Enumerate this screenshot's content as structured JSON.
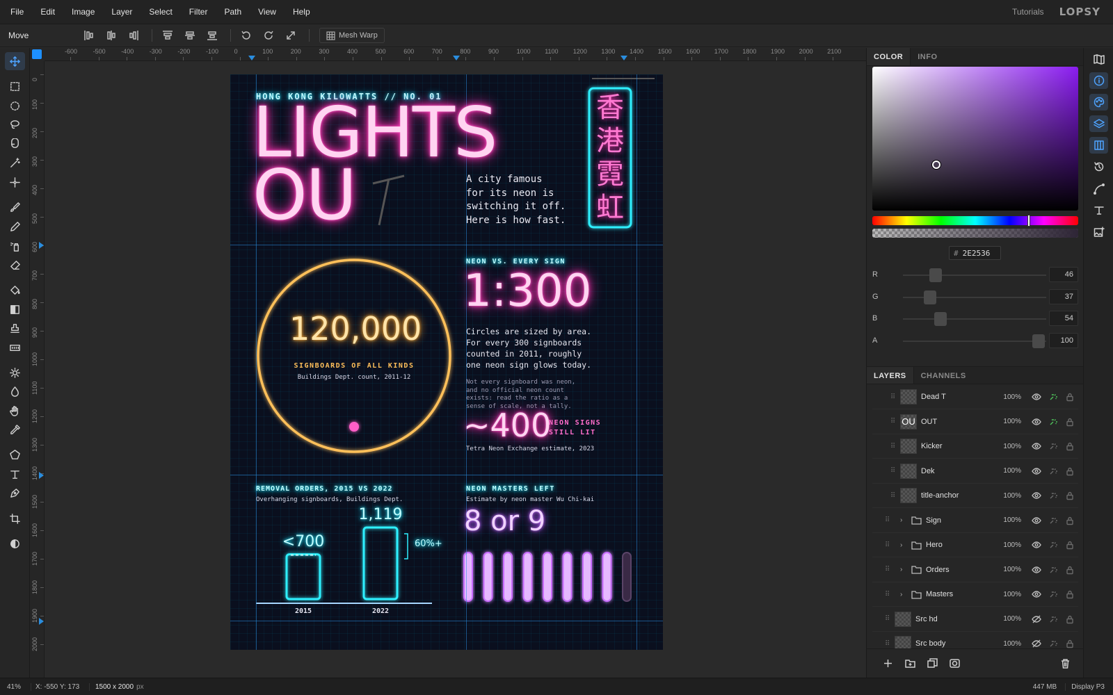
{
  "menu": [
    "File",
    "Edit",
    "Image",
    "Layer",
    "Select",
    "Filter",
    "Path",
    "View",
    "Help"
  ],
  "header": {
    "tutorials": "Tutorials",
    "logo": "LOPSY"
  },
  "options": {
    "tool_name": "Move",
    "mesh_warp": "Mesh Warp"
  },
  "rulers": {
    "top": [
      "-600",
      "-500",
      "-400",
      "-300",
      "-200",
      "-100",
      "0",
      "100",
      "200",
      "300",
      "400",
      "500",
      "600",
      "700",
      "800",
      "900",
      "1000",
      "1100",
      "1200",
      "1300",
      "1400",
      "1500",
      "1600",
      "1700",
      "1800",
      "1900",
      "2000",
      "2100"
    ],
    "left": [
      "0",
      "100",
      "200",
      "300",
      "400",
      "500",
      "600",
      "700",
      "800",
      "900",
      "1000",
      "1100",
      "1200",
      "1300",
      "1400",
      "1500",
      "1600",
      "1700",
      "1800",
      "1900",
      "2000"
    ]
  },
  "poster": {
    "kicker": "HONG KONG KILOWATTS  //  NO. 01",
    "title_line1": "LIGHTS",
    "title_line2": "OU",
    "title_dead": "T",
    "dek": [
      "A city famous",
      "for its neon is",
      "switching it off.",
      "Here is how fast."
    ],
    "sign_chars": [
      "香",
      "港",
      "霓",
      "虹"
    ],
    "big_number": "120,000",
    "big_label": "SIGNBOARDS OF ALL KINDS",
    "big_source": "Buildings Dept. count, 2011-12",
    "ratio_kicker": "NEON VS. EVERY SIGN",
    "ratio": "1:300",
    "ratio_text": [
      "Circles are sized by area.",
      "For every 300 signboards",
      "counted in 2011, roughly",
      "one neon sign glows today."
    ],
    "note": [
      "Not every signboard was neon,",
      "and no official neon count",
      "exists: read the ratio as a",
      "sense of scale, not a tally."
    ],
    "small_number": "~400",
    "small_label": [
      "NEON SIGNS",
      "STILL LIT"
    ],
    "small_source": "Tetra Neon Exchange estimate, 2023",
    "orders_title": "REMOVAL ORDERS, 2015 VS 2022",
    "orders_sub": "Overhanging signboards, Buildings Dept.",
    "bars": [
      {
        "label": "<700",
        "year": "2015",
        "value": 700
      },
      {
        "label": "1,119",
        "year": "2022",
        "value": 1119
      }
    ],
    "bar_delta": "60%+",
    "masters_title": "NEON MASTERS LEFT",
    "masters_sub": "Estimate by neon master Wu Chi-kai",
    "masters_value": "8 or 9",
    "masters_lit": 8,
    "masters_total": 9
  },
  "color_panel": {
    "tabs": [
      "COLOR",
      "INFO"
    ],
    "hex_prefix": "#",
    "hex": "2E2536",
    "hue_fraction": 0.76,
    "channels": [
      {
        "name": "R",
        "value": "46",
        "fraction": 0.2
      },
      {
        "name": "G",
        "value": "37",
        "fraction": 0.16
      },
      {
        "name": "B",
        "value": "54",
        "fraction": 0.24
      },
      {
        "name": "A",
        "value": "100",
        "fraction": 0.99
      }
    ]
  },
  "layers_panel": {
    "tabs": [
      "LAYERS",
      "CHANNELS"
    ],
    "layers": [
      {
        "name": "Dead T",
        "opacity": "100%",
        "type": "layer",
        "thumb": "",
        "fx": true,
        "hidden": false
      },
      {
        "name": "OUT",
        "opacity": "100%",
        "type": "layer",
        "thumb": "OU",
        "fx": true,
        "hidden": false
      },
      {
        "name": "Kicker",
        "opacity": "100%",
        "type": "layer",
        "thumb": "",
        "fx": false,
        "hidden": false
      },
      {
        "name": "Dek",
        "opacity": "100%",
        "type": "layer",
        "thumb": "",
        "fx": false,
        "hidden": false
      },
      {
        "name": "title-anchor",
        "opacity": "100%",
        "type": "layer",
        "thumb": "",
        "fx": false,
        "hidden": false
      },
      {
        "name": "Sign",
        "opacity": "100%",
        "type": "group",
        "thumb": "",
        "fx": false,
        "hidden": false
      },
      {
        "name": "Hero",
        "opacity": "100%",
        "type": "group",
        "thumb": "",
        "fx": false,
        "hidden": false
      },
      {
        "name": "Orders",
        "opacity": "100%",
        "type": "group",
        "thumb": "",
        "fx": false,
        "hidden": false
      },
      {
        "name": "Masters",
        "opacity": "100%",
        "type": "group",
        "thumb": "",
        "fx": false,
        "hidden": false
      },
      {
        "name": "Src hd",
        "opacity": "100%",
        "type": "layer",
        "thumb": "",
        "fx": false,
        "hidden": true
      },
      {
        "name": "Src body",
        "opacity": "100%",
        "type": "layer",
        "thumb": "",
        "fx": false,
        "hidden": true
      }
    ]
  },
  "status": {
    "zoom": "41%",
    "coords": "X: -550  Y: 173",
    "size": "1500 x 2000",
    "size_unit": "px",
    "memory": "447 MB",
    "profile": "Display P3"
  },
  "colors": {
    "accent": "#4ea3ff",
    "neon_pink": "#ff2fb0",
    "neon_cyan": "#2ef0ff",
    "neon_amber": "#ffb640",
    "neon_violet": "#c96cff"
  }
}
